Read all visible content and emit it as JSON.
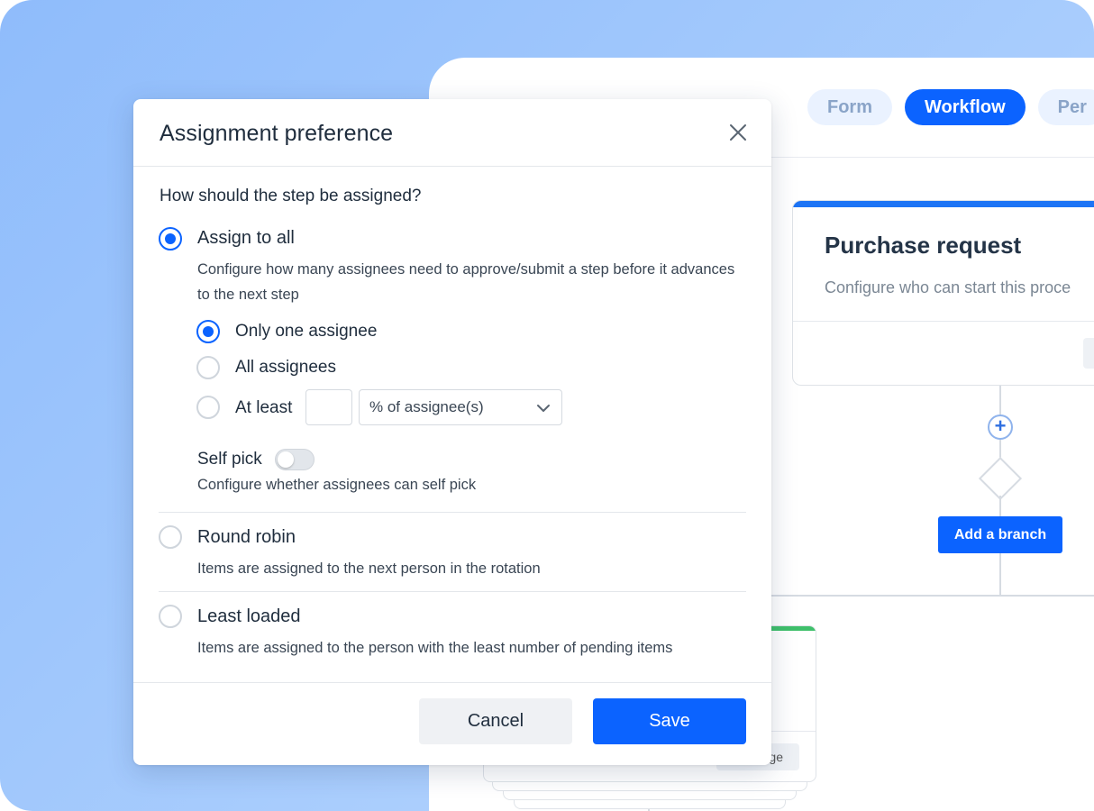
{
  "tabs": [
    {
      "label": "Form",
      "active": false
    },
    {
      "label": "Workflow",
      "active": true
    },
    {
      "label": "Per",
      "active": false
    }
  ],
  "workflow": {
    "card_title": "Purchase request",
    "card_subtitle": "Configure who can start this proce",
    "add_branch_label": "Add a branch",
    "lower_card_button": "ge"
  },
  "modal": {
    "title": "Assignment preference",
    "question": "How should the step be assigned?",
    "options": [
      {
        "label": "Assign to all",
        "selected": true,
        "description": "Configure how many assignees need to approve/submit a step before it advances to the next step"
      },
      {
        "label": "Round robin",
        "selected": false,
        "description": "Items are assigned to the next person in the rotation"
      },
      {
        "label": "Least loaded",
        "selected": false,
        "description": "Items are assigned to the person with the least number of pending items"
      }
    ],
    "sub_options": [
      {
        "label": "Only one assignee",
        "selected": true
      },
      {
        "label": "All assignees",
        "selected": false
      },
      {
        "label": "At least",
        "selected": false
      }
    ],
    "at_least": {
      "value": "",
      "select_value": "% of assignee(s)"
    },
    "self_pick": {
      "label": "Self pick",
      "enabled": false,
      "description": "Configure whether assignees can self pick"
    },
    "cancel_label": "Cancel",
    "save_label": "Save"
  },
  "colors": {
    "accent": "#0b63ff",
    "background_gradient_start": "#8fbcfb",
    "success_bar": "#3fc06b"
  }
}
